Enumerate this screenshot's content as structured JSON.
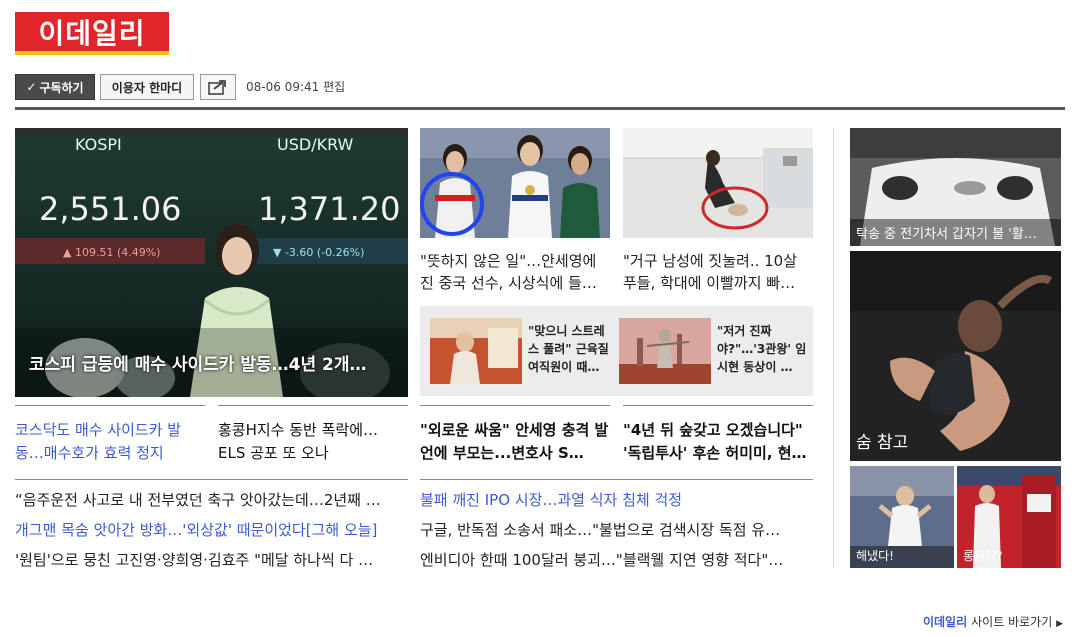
{
  "header": {
    "logo_text": "이데일리"
  },
  "toolbar": {
    "subscribe_check": "✓",
    "subscribe_label": "구독하기",
    "comment_label": "이용자 한마디",
    "timestamp": "08-06 09:41 편집"
  },
  "main_feature": {
    "caption": "코스피 급등에 매수 사이드카 발동…4년 2개…",
    "board_left_label": "KOSPI",
    "board_left_value": "2,551.06",
    "board_left_change": "▲ 109.51 (4.49%)",
    "board_right_label": "USD/KRW",
    "board_right_value": "1,371.20",
    "board_right_change": "▼ -3.60 (-0.26%)"
  },
  "thumbs": [
    {
      "title": "\"뜻하지 않은 일\"…안세영에 진 중국 선수, 시상식에 들…"
    },
    {
      "title": "\"거구 남성에 짓눌려.. 10살 푸들, 학대에 이빨까지 빠…"
    }
  ],
  "mini_cards": [
    {
      "title": "\"맞으니 스트레스 풀려\" 근육질 여직원이 때…"
    },
    {
      "title": "\"저거 진짜야?\"…'3관왕' 임시현 동상이 …"
    }
  ],
  "headlines": [
    {
      "text": "코스닥도 매수 사이드카 발동…매수호가 효력 정지"
    },
    {
      "text": "홍콩H지수 동반 폭락에… ELS 공포 또 오나"
    },
    {
      "text": "\"외로운 싸움\" 안세영 충격 발언에 부모는...변호사 S…"
    },
    {
      "text": "\"4년 뒤 숲갖고 오겠습니다\" '독립투사' 후손 허미미, 현…"
    }
  ],
  "list_left": [
    "“음주운전 사고로 내 전부였던 축구 앗아갔는데…2년째 …",
    "개그맨 목숨 앗아간 방화…'외상값' 때문이었다[그해 오늘]",
    "'원팀'으로 뭉친 고진영·양희영·김효주 \"메달 하나씩 다 …"
  ],
  "list_right": [
    "불패 깨진 IPO 시장…과열 식자 침체 걱정",
    "구글, 반독점 소송서 패소…\"불법으로 검색시장 독점 유…",
    "엔비디아 한때 100달러 붕괴…\"블랙웰 지연 영향 적다\"…"
  ],
  "sidebar": {
    "top_caption": "탁송 중 전기차서 갑자기 불 '활…",
    "diver_caption": "숨 참고",
    "bottom_left_caption": "해냈다!",
    "bottom_right_caption": "롱패딩?"
  },
  "footer": {
    "brand": "이데일리",
    "link": "사이트 바로가기"
  },
  "colors": {
    "brand_red": "#e0262b",
    "brand_yellow": "#f4c21b",
    "link_blue": "#3b5bd6"
  }
}
